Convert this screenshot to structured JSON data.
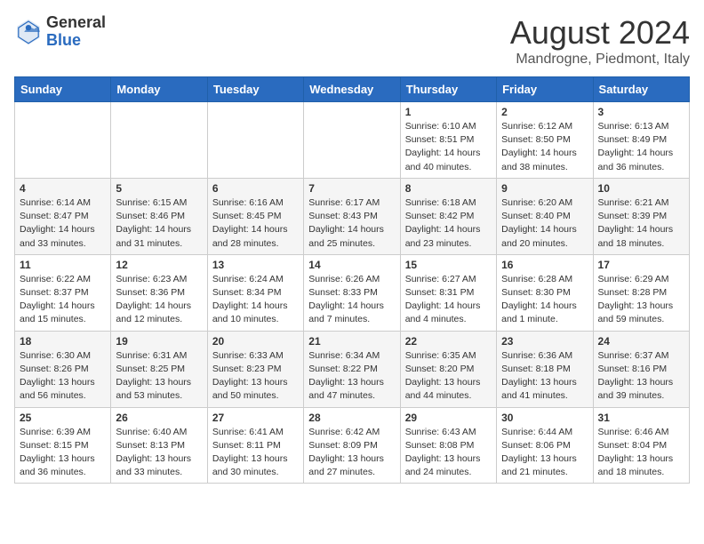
{
  "header": {
    "logo_general": "General",
    "logo_blue": "Blue",
    "month_title": "August 2024",
    "location": "Mandrogne, Piedmont, Italy"
  },
  "days_of_week": [
    "Sunday",
    "Monday",
    "Tuesday",
    "Wednesday",
    "Thursday",
    "Friday",
    "Saturday"
  ],
  "weeks": [
    [
      {
        "day": "",
        "info": ""
      },
      {
        "day": "",
        "info": ""
      },
      {
        "day": "",
        "info": ""
      },
      {
        "day": "",
        "info": ""
      },
      {
        "day": "1",
        "info": "Sunrise: 6:10 AM\nSunset: 8:51 PM\nDaylight: 14 hours\nand 40 minutes."
      },
      {
        "day": "2",
        "info": "Sunrise: 6:12 AM\nSunset: 8:50 PM\nDaylight: 14 hours\nand 38 minutes."
      },
      {
        "day": "3",
        "info": "Sunrise: 6:13 AM\nSunset: 8:49 PM\nDaylight: 14 hours\nand 36 minutes."
      }
    ],
    [
      {
        "day": "4",
        "info": "Sunrise: 6:14 AM\nSunset: 8:47 PM\nDaylight: 14 hours\nand 33 minutes."
      },
      {
        "day": "5",
        "info": "Sunrise: 6:15 AM\nSunset: 8:46 PM\nDaylight: 14 hours\nand 31 minutes."
      },
      {
        "day": "6",
        "info": "Sunrise: 6:16 AM\nSunset: 8:45 PM\nDaylight: 14 hours\nand 28 minutes."
      },
      {
        "day": "7",
        "info": "Sunrise: 6:17 AM\nSunset: 8:43 PM\nDaylight: 14 hours\nand 25 minutes."
      },
      {
        "day": "8",
        "info": "Sunrise: 6:18 AM\nSunset: 8:42 PM\nDaylight: 14 hours\nand 23 minutes."
      },
      {
        "day": "9",
        "info": "Sunrise: 6:20 AM\nSunset: 8:40 PM\nDaylight: 14 hours\nand 20 minutes."
      },
      {
        "day": "10",
        "info": "Sunrise: 6:21 AM\nSunset: 8:39 PM\nDaylight: 14 hours\nand 18 minutes."
      }
    ],
    [
      {
        "day": "11",
        "info": "Sunrise: 6:22 AM\nSunset: 8:37 PM\nDaylight: 14 hours\nand 15 minutes."
      },
      {
        "day": "12",
        "info": "Sunrise: 6:23 AM\nSunset: 8:36 PM\nDaylight: 14 hours\nand 12 minutes."
      },
      {
        "day": "13",
        "info": "Sunrise: 6:24 AM\nSunset: 8:34 PM\nDaylight: 14 hours\nand 10 minutes."
      },
      {
        "day": "14",
        "info": "Sunrise: 6:26 AM\nSunset: 8:33 PM\nDaylight: 14 hours\nand 7 minutes."
      },
      {
        "day": "15",
        "info": "Sunrise: 6:27 AM\nSunset: 8:31 PM\nDaylight: 14 hours\nand 4 minutes."
      },
      {
        "day": "16",
        "info": "Sunrise: 6:28 AM\nSunset: 8:30 PM\nDaylight: 14 hours\nand 1 minute."
      },
      {
        "day": "17",
        "info": "Sunrise: 6:29 AM\nSunset: 8:28 PM\nDaylight: 13 hours\nand 59 minutes."
      }
    ],
    [
      {
        "day": "18",
        "info": "Sunrise: 6:30 AM\nSunset: 8:26 PM\nDaylight: 13 hours\nand 56 minutes."
      },
      {
        "day": "19",
        "info": "Sunrise: 6:31 AM\nSunset: 8:25 PM\nDaylight: 13 hours\nand 53 minutes."
      },
      {
        "day": "20",
        "info": "Sunrise: 6:33 AM\nSunset: 8:23 PM\nDaylight: 13 hours\nand 50 minutes."
      },
      {
        "day": "21",
        "info": "Sunrise: 6:34 AM\nSunset: 8:22 PM\nDaylight: 13 hours\nand 47 minutes."
      },
      {
        "day": "22",
        "info": "Sunrise: 6:35 AM\nSunset: 8:20 PM\nDaylight: 13 hours\nand 44 minutes."
      },
      {
        "day": "23",
        "info": "Sunrise: 6:36 AM\nSunset: 8:18 PM\nDaylight: 13 hours\nand 41 minutes."
      },
      {
        "day": "24",
        "info": "Sunrise: 6:37 AM\nSunset: 8:16 PM\nDaylight: 13 hours\nand 39 minutes."
      }
    ],
    [
      {
        "day": "25",
        "info": "Sunrise: 6:39 AM\nSunset: 8:15 PM\nDaylight: 13 hours\nand 36 minutes."
      },
      {
        "day": "26",
        "info": "Sunrise: 6:40 AM\nSunset: 8:13 PM\nDaylight: 13 hours\nand 33 minutes."
      },
      {
        "day": "27",
        "info": "Sunrise: 6:41 AM\nSunset: 8:11 PM\nDaylight: 13 hours\nand 30 minutes."
      },
      {
        "day": "28",
        "info": "Sunrise: 6:42 AM\nSunset: 8:09 PM\nDaylight: 13 hours\nand 27 minutes."
      },
      {
        "day": "29",
        "info": "Sunrise: 6:43 AM\nSunset: 8:08 PM\nDaylight: 13 hours\nand 24 minutes."
      },
      {
        "day": "30",
        "info": "Sunrise: 6:44 AM\nSunset: 8:06 PM\nDaylight: 13 hours\nand 21 minutes."
      },
      {
        "day": "31",
        "info": "Sunrise: 6:46 AM\nSunset: 8:04 PM\nDaylight: 13 hours\nand 18 minutes."
      }
    ]
  ]
}
